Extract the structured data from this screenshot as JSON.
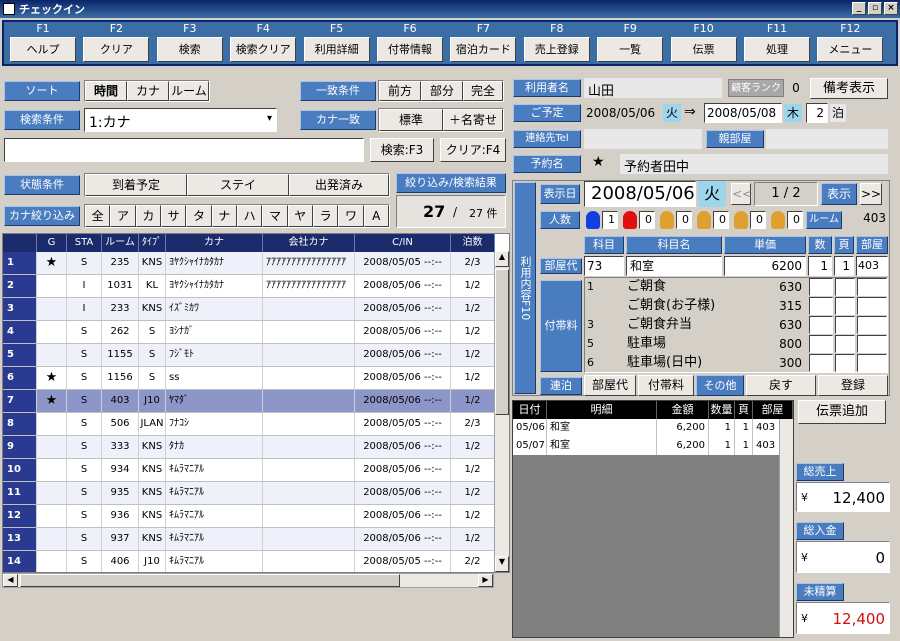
{
  "window": {
    "title": "チェックイン",
    "min": "_",
    "max": "▫",
    "close": "×"
  },
  "fkeys": [
    {
      "k": "F1",
      "l": "ヘルプ"
    },
    {
      "k": "F2",
      "l": "クリア"
    },
    {
      "k": "F3",
      "l": "検索"
    },
    {
      "k": "F4",
      "l": "検索クリア"
    },
    {
      "k": "F5",
      "l": "利用詳細"
    },
    {
      "k": "F6",
      "l": "付帯情報"
    },
    {
      "k": "F7",
      "l": "宿泊カード"
    },
    {
      "k": "F8",
      "l": "売上登録"
    },
    {
      "k": "F9",
      "l": "一覧"
    },
    {
      "k": "F10",
      "l": "伝票"
    },
    {
      "k": "F11",
      "l": "処理"
    },
    {
      "k": "F12",
      "l": "メニュー"
    }
  ],
  "left": {
    "sort_label": "ソート",
    "sort_opts": [
      "時間",
      "カナ",
      "ルーム"
    ],
    "match_label": "一致条件",
    "match_opts": [
      "前方",
      "部分",
      "完全"
    ],
    "search_cond_label": "検索条件",
    "search_cond_value": "1:カナ",
    "search_cond_arrow": "▾",
    "kana_match_label": "カナ一致",
    "kana_match_opts": [
      "標準",
      "＋名寄せ"
    ],
    "search_btn": "検索:F3",
    "clear_btn": "クリア:F4",
    "status_label": "状態条件",
    "status_opts": [
      "到着予定",
      "ステイ",
      "出発済み"
    ],
    "filter_result_label": "絞り込み/検索結果",
    "result_count": "27",
    "result_sep": "/",
    "result_total": "27 件",
    "kana_filter_label": "カナ絞り込み",
    "kana_opts": [
      "全",
      "ア",
      "カ",
      "サ",
      "タ",
      "ナ",
      "ハ",
      "マ",
      "ヤ",
      "ラ",
      "ワ",
      "A"
    ]
  },
  "grid": {
    "headers": [
      "",
      "G",
      "STA",
      "ルーム",
      "ﾀｲﾌﾟ",
      "カナ",
      "会社カナ",
      "C/IN",
      "泊数"
    ],
    "rows": [
      {
        "n": "1",
        "g": "★",
        "sta": "S",
        "room": "235",
        "type": "KNS",
        "kana": "ﾖﾔｸｼｬｲﾅｶﾀｶﾅ",
        "co": "ｱｱｱｱｱｱｱｱｱｱｱｱｱｱｱｱ",
        "cin": "2008/05/05 --:--",
        "n2": "2/3"
      },
      {
        "n": "2",
        "g": "",
        "sta": "I",
        "room": "1031",
        "type": "KL",
        "kana": "ﾖﾔｸｼｬｲﾅｶﾀｶﾅ",
        "co": "ｱｱｱｱｱｱｱｱｱｱｱｱｱｱｱｱ",
        "cin": "2008/05/06 --:--",
        "n2": "1/2"
      },
      {
        "n": "3",
        "g": "",
        "sta": "I",
        "room": "233",
        "type": "KNS",
        "kana": "ｲｽﾞﾐｶﾜ",
        "co": "",
        "cin": "2008/05/06 --:--",
        "n2": "1/2"
      },
      {
        "n": "4",
        "g": "",
        "sta": "S",
        "room": "262",
        "type": "S",
        "kana": "ﾖｼﾅｶﾞ",
        "co": "",
        "cin": "2008/05/06 --:--",
        "n2": "1/2"
      },
      {
        "n": "5",
        "g": "",
        "sta": "S",
        "room": "1155",
        "type": "S",
        "kana": "ﾌｼﾞﾓﾄ",
        "co": "",
        "cin": "2008/05/06 --:--",
        "n2": "1/2"
      },
      {
        "n": "6",
        "g": "★",
        "sta": "S",
        "room": "1156",
        "type": "S",
        "kana": "ss",
        "co": "",
        "cin": "2008/05/06 --:--",
        "n2": "1/2"
      },
      {
        "n": "7",
        "g": "★",
        "sta": "S",
        "room": "403",
        "type": "J10",
        "kana": "ﾔﾏﾀﾞ",
        "co": "",
        "cin": "2008/05/06 --:--",
        "n2": "1/2"
      },
      {
        "n": "8",
        "g": "",
        "sta": "S",
        "room": "506",
        "type": "JLAN",
        "kana": "ﾌﾅｺｼ",
        "co": "",
        "cin": "2008/05/05 --:--",
        "n2": "2/3"
      },
      {
        "n": "9",
        "g": "",
        "sta": "S",
        "room": "333",
        "type": "KNS",
        "kana": "ﾀﾅｶ",
        "co": "",
        "cin": "2008/05/06 --:--",
        "n2": "1/2"
      },
      {
        "n": "10",
        "g": "",
        "sta": "S",
        "room": "934",
        "type": "KNS",
        "kana": "ｷﾑﾗﾏﾆｱﾙ",
        "co": "",
        "cin": "2008/05/06 --:--",
        "n2": "1/2"
      },
      {
        "n": "11",
        "g": "",
        "sta": "S",
        "room": "935",
        "type": "KNS",
        "kana": "ｷﾑﾗﾏﾆｱﾙ",
        "co": "",
        "cin": "2008/05/06 --:--",
        "n2": "1/2"
      },
      {
        "n": "12",
        "g": "",
        "sta": "S",
        "room": "936",
        "type": "KNS",
        "kana": "ｷﾑﾗﾏﾆｱﾙ",
        "co": "",
        "cin": "2008/05/06 --:--",
        "n2": "1/2"
      },
      {
        "n": "13",
        "g": "",
        "sta": "S",
        "room": "937",
        "type": "KNS",
        "kana": "ｷﾑﾗﾏﾆｱﾙ",
        "co": "",
        "cin": "2008/05/06 --:--",
        "n2": "1/2"
      },
      {
        "n": "14",
        "g": "",
        "sta": "S",
        "room": "406",
        "type": "J10",
        "kana": "ｷﾑﾗﾏﾆｱﾙ",
        "co": "",
        "cin": "2008/05/05 --:--",
        "n2": "2/2"
      }
    ],
    "selected_row": "7"
  },
  "right": {
    "user_label": "利用者名",
    "user_value": "山田",
    "rank_label": "顧客ランク",
    "rank_value": "0",
    "memo_btn": "備考表示",
    "stay_label": "ご予定",
    "date_from": "2008/05/06",
    "dow_from": "火",
    "arrow": "⇒",
    "date_to": "2008/05/08",
    "dow_to": "木",
    "nights": "2",
    "nights_unit": "泊",
    "contact_label": "連絡先Tel",
    "contact_value": "",
    "parent_room_label": "親部屋",
    "parent_room_value": "",
    "booking_label": "予約名",
    "booking_mark": "★",
    "booking_value": "予約者田中",
    "side_label": "利用内容F10",
    "display_date_label": "表示日",
    "display_date": "2008/05/06",
    "display_dow": "火",
    "prev": "<<",
    "page": "1 / 2",
    "show_btn": "表示",
    "next": ">>",
    "people_label": "人数",
    "people": [
      "1",
      "0",
      "0",
      "0",
      "0",
      "0"
    ],
    "room_label": "ルーム",
    "room_value": "403",
    "col_code": "科目",
    "col_name": "科目名",
    "col_price": "単価",
    "col_qty": "数",
    "col_page": "頁",
    "col_room": "部屋",
    "room_fee_label": "部屋代",
    "room_fee_code": "73",
    "room_fee_name": "和室",
    "room_fee_price": "6200",
    "room_fee_qty": "1",
    "room_fee_page": "1",
    "room_fee_room": "403",
    "extras_label": "付帯料",
    "extras": [
      {
        "c": "1",
        "name": "ご朝食",
        "price": "630"
      },
      {
        "c": "",
        "name": "ご朝食(お子様)",
        "price": "315"
      },
      {
        "c": "3",
        "name": "ご朝食弁当",
        "price": "630"
      },
      {
        "c": "5",
        "name": "駐車場",
        "price": "800"
      },
      {
        "c": "6",
        "name": "駐車場(日中)",
        "price": "300"
      }
    ],
    "consec_label": "連泊",
    "tab_room": "部屋代",
    "tab_extra": "付帯料",
    "tab_other": "その他",
    "back_btn": "戻す",
    "register_btn": "登録",
    "slip_headers": [
      "日付",
      "明細",
      "金額",
      "数量",
      "頁",
      "部屋"
    ],
    "slips": [
      {
        "d": "05/06",
        "desc": "和室",
        "amt": "6,200",
        "q": "1",
        "p": "1",
        "r": "403"
      },
      {
        "d": "05/07",
        "desc": "和室",
        "amt": "6,200",
        "q": "1",
        "p": "1",
        "r": "403"
      }
    ],
    "slip_add_btn": "伝票追加",
    "total_sales_label": "総売上",
    "total_sales": "12,400",
    "total_paid_label": "総入金",
    "total_paid": "0",
    "unsettled_label": "未精算",
    "unsettled": "12,400",
    "yen": "¥"
  }
}
